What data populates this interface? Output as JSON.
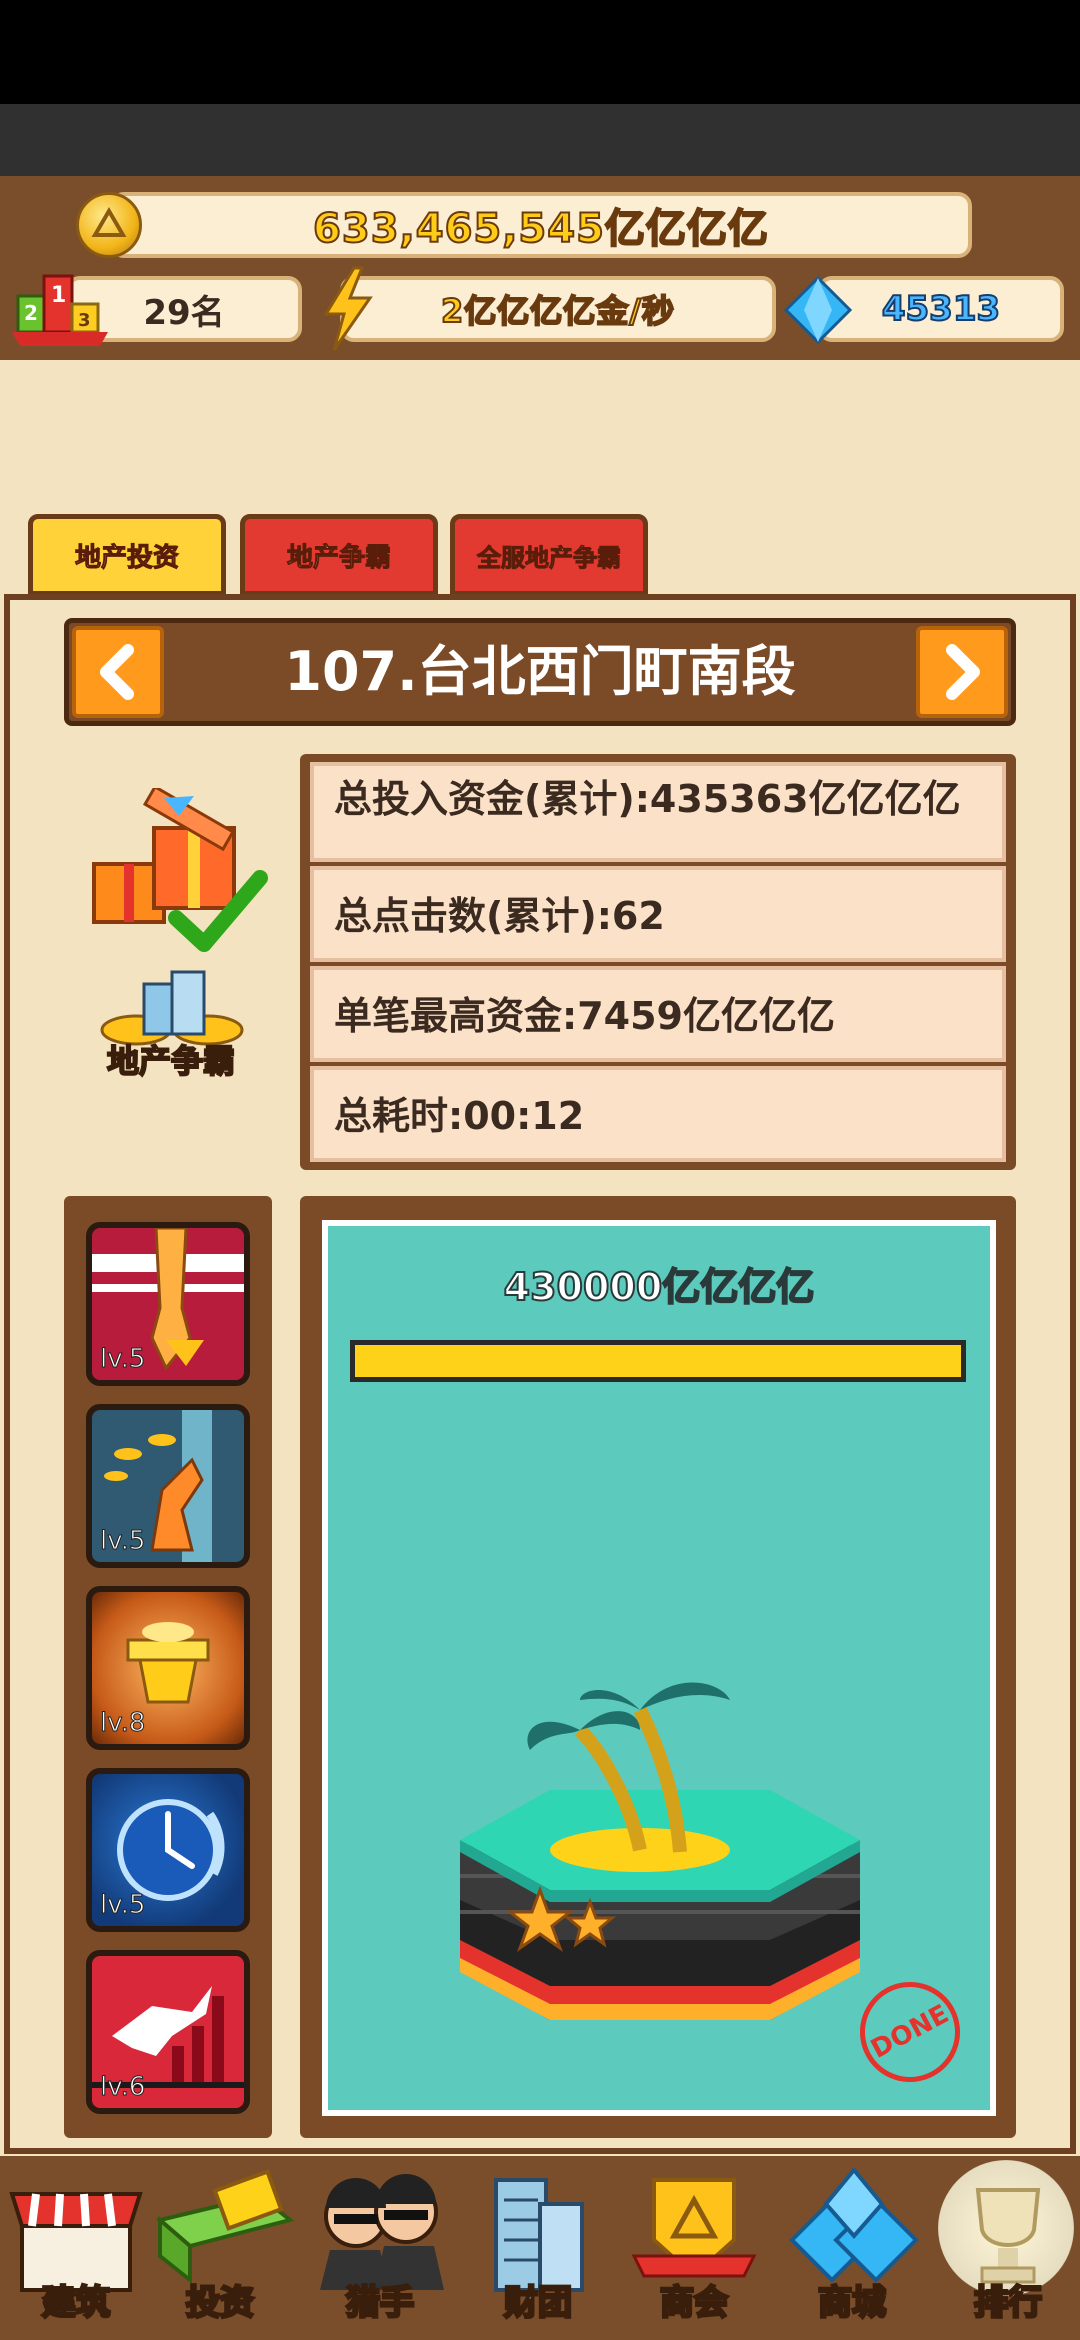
{
  "header": {
    "gold_amount": "633,465,545亿亿亿亿",
    "rank_text": "29名",
    "income_rate": "2亿亿亿亿金/秒",
    "diamonds": "45313"
  },
  "tabs": [
    {
      "label": "地产投资",
      "active": true
    },
    {
      "label": "地产争霸",
      "active": false
    },
    {
      "label": "全服地产争霸",
      "active": false
    }
  ],
  "property": {
    "title": "107.台北西门町南段",
    "stats": [
      "总投入资金(累计):435363亿亿亿亿",
      "总点击数(累计):62",
      "单笔最高资金:7459亿亿亿亿",
      "总耗时:00:12"
    ],
    "side_label": "地产争霸",
    "target_amount": "430000亿亿亿亿",
    "progress": 1.0,
    "stamp_text": "DONE"
  },
  "skills": [
    {
      "level": "lv.5",
      "icon": "fist-down-icon"
    },
    {
      "level": "lv.5",
      "icon": "coin-hand-icon"
    },
    {
      "level": "lv.8",
      "icon": "gold-chest-icon"
    },
    {
      "level": "lv.5",
      "icon": "clock-icon"
    },
    {
      "level": "lv.6",
      "icon": "bull-chart-icon"
    }
  ],
  "bottom_nav": [
    {
      "label": "建筑",
      "icon": "shop-icon"
    },
    {
      "label": "投资",
      "icon": "invest-icon"
    },
    {
      "label": "猎手",
      "icon": "hunters-icon"
    },
    {
      "label": "财团",
      "icon": "buildings-icon"
    },
    {
      "label": "商会",
      "icon": "badge-icon"
    },
    {
      "label": "商城",
      "icon": "diamond-store-icon"
    },
    {
      "label": "排行",
      "icon": "trophy-icon"
    }
  ],
  "colors": {
    "board_bg": "#6e4022",
    "panel_bg": "#f4e3c1",
    "scene_teal": "#5ccabd",
    "progress_yellow": "#ffd21a",
    "arrow_orange": "#ff9a1c",
    "tab_active": "#ffd23a",
    "tab_inactive": "#e23a30"
  }
}
